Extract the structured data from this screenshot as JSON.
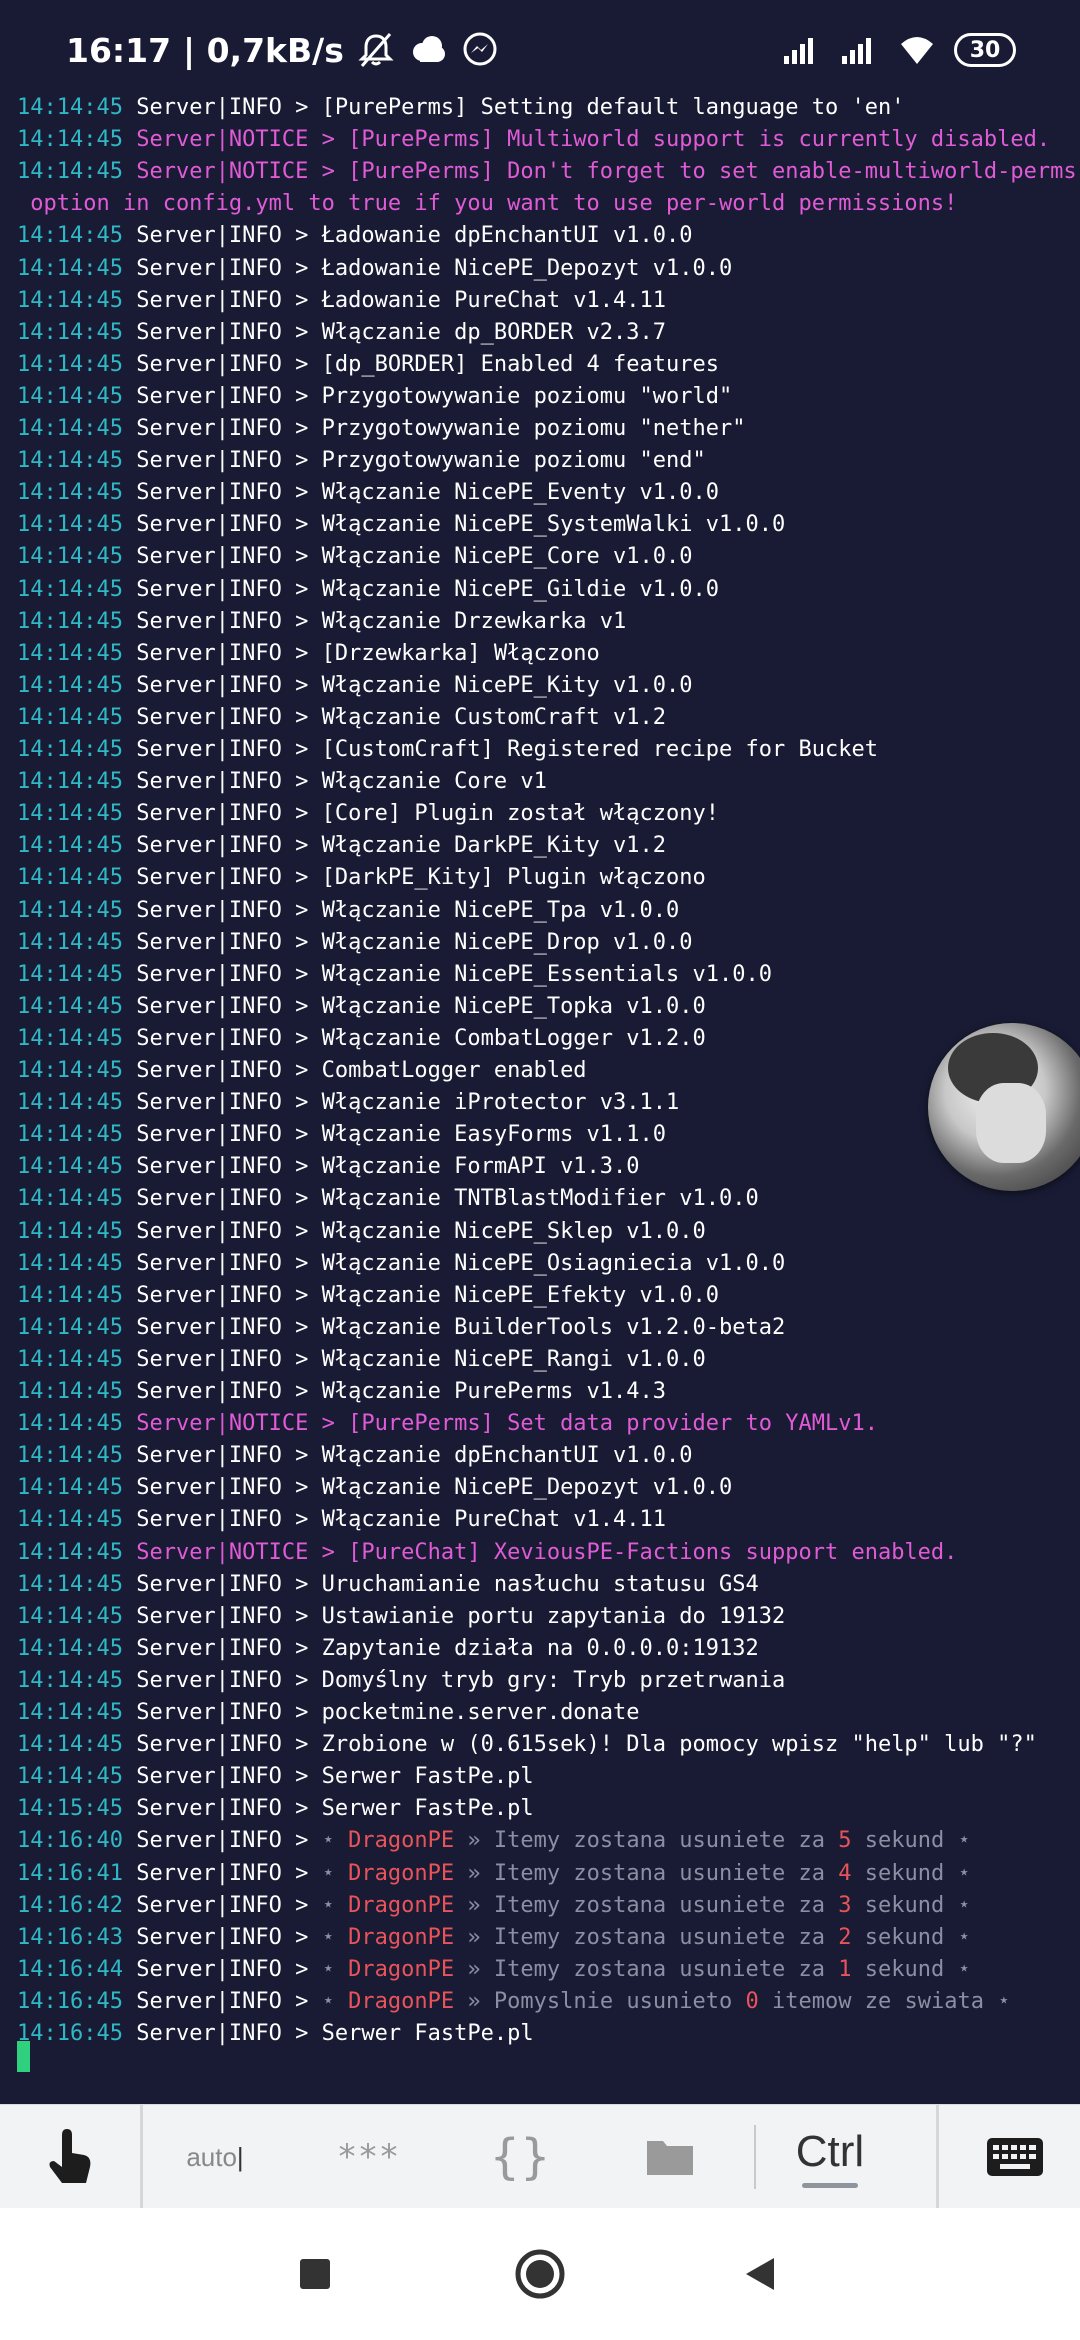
{
  "status_bar": {
    "time": "16:17",
    "network_speed": "| 0,7kB/s",
    "battery": "30",
    "icons": [
      "bell-off-icon",
      "cloud-icon",
      "messenger-icon",
      "signal-icon",
      "signal-icon",
      "wifi-icon"
    ]
  },
  "console": {
    "lines": [
      {
        "ts": "14:14:45",
        "kind": "info",
        "msg": "Server|INFO > [PurePerms] Setting default language to 'en'"
      },
      {
        "ts": "14:14:45",
        "kind": "notice",
        "msg": "Server|NOTICE > [PurePerms] Multiworld support is currently disabled."
      },
      {
        "ts": "14:14:45",
        "kind": "notice",
        "msg": "Server|NOTICE > [PurePerms] Don't forget to set enable-multiworld-perms"
      },
      {
        "ts": "",
        "kind": "notice",
        "msg": " option in config.yml to true if you want to use per-world permissions!"
      },
      {
        "ts": "14:14:45",
        "kind": "info",
        "msg": "Server|INFO > Ładowanie dpEnchantUI v1.0.0"
      },
      {
        "ts": "14:14:45",
        "kind": "info",
        "msg": "Server|INFO > Ładowanie NicePE_Depozyt v1.0.0"
      },
      {
        "ts": "14:14:45",
        "kind": "info",
        "msg": "Server|INFO > Ładowanie PureChat v1.4.11"
      },
      {
        "ts": "14:14:45",
        "kind": "info",
        "msg": "Server|INFO > Włączanie dp_BORDER v2.3.7"
      },
      {
        "ts": "14:14:45",
        "kind": "info",
        "msg": "Server|INFO > [dp_BORDER] Enabled 4 features"
      },
      {
        "ts": "14:14:45",
        "kind": "info",
        "msg": "Server|INFO > Przygotowywanie poziomu \"world\""
      },
      {
        "ts": "14:14:45",
        "kind": "info",
        "msg": "Server|INFO > Przygotowywanie poziomu \"nether\""
      },
      {
        "ts": "14:14:45",
        "kind": "info",
        "msg": "Server|INFO > Przygotowywanie poziomu \"end\""
      },
      {
        "ts": "14:14:45",
        "kind": "info",
        "msg": "Server|INFO > Włączanie NicePE_Eventy v1.0.0"
      },
      {
        "ts": "14:14:45",
        "kind": "info",
        "msg": "Server|INFO > Włączanie NicePE_SystemWalki v1.0.0"
      },
      {
        "ts": "14:14:45",
        "kind": "info",
        "msg": "Server|INFO > Włączanie NicePE_Core v1.0.0"
      },
      {
        "ts": "14:14:45",
        "kind": "info",
        "msg": "Server|INFO > Włączanie NicePE_Gildie v1.0.0"
      },
      {
        "ts": "14:14:45",
        "kind": "info",
        "msg": "Server|INFO > Włączanie Drzewkarka v1"
      },
      {
        "ts": "14:14:45",
        "kind": "info",
        "msg": "Server|INFO > [Drzewkarka] Włączono"
      },
      {
        "ts": "14:14:45",
        "kind": "info",
        "msg": "Server|INFO > Włączanie NicePE_Kity v1.0.0"
      },
      {
        "ts": "14:14:45",
        "kind": "info",
        "msg": "Server|INFO > Włączanie CustomCraft v1.2"
      },
      {
        "ts": "14:14:45",
        "kind": "info",
        "msg": "Server|INFO > [CustomCraft] Registered recipe for Bucket"
      },
      {
        "ts": "14:14:45",
        "kind": "info",
        "msg": "Server|INFO > Włączanie Core v1"
      },
      {
        "ts": "14:14:45",
        "kind": "info",
        "msg": "Server|INFO > [Core] Plugin został włączony!"
      },
      {
        "ts": "14:14:45",
        "kind": "info",
        "msg": "Server|INFO > Włączanie DarkPE_Kity v1.2"
      },
      {
        "ts": "14:14:45",
        "kind": "info",
        "msg": "Server|INFO > [DarkPE_Kity] Plugin włączono"
      },
      {
        "ts": "14:14:45",
        "kind": "info",
        "msg": "Server|INFO > Włączanie NicePE_Tpa v1.0.0"
      },
      {
        "ts": "14:14:45",
        "kind": "info",
        "msg": "Server|INFO > Włączanie NicePE_Drop v1.0.0"
      },
      {
        "ts": "14:14:45",
        "kind": "info",
        "msg": "Server|INFO > Włączanie NicePE_Essentials v1.0.0"
      },
      {
        "ts": "14:14:45",
        "kind": "info",
        "msg": "Server|INFO > Włączanie NicePE_Topka v1.0.0"
      },
      {
        "ts": "14:14:45",
        "kind": "info",
        "msg": "Server|INFO > Włączanie CombatLogger v1.2.0"
      },
      {
        "ts": "14:14:45",
        "kind": "info",
        "msg": "Server|INFO > CombatLogger enabled"
      },
      {
        "ts": "14:14:45",
        "kind": "info",
        "msg": "Server|INFO > Włączanie iProtector v3.1.1"
      },
      {
        "ts": "14:14:45",
        "kind": "info",
        "msg": "Server|INFO > Włączanie EasyForms v1.1.0"
      },
      {
        "ts": "14:14:45",
        "kind": "info",
        "msg": "Server|INFO > Włączanie FormAPI v1.3.0"
      },
      {
        "ts": "14:14:45",
        "kind": "info",
        "msg": "Server|INFO > Włączanie TNTBlastModifier v1.0.0"
      },
      {
        "ts": "14:14:45",
        "kind": "info",
        "msg": "Server|INFO > Włączanie NicePE_Sklep v1.0.0"
      },
      {
        "ts": "14:14:45",
        "kind": "info",
        "msg": "Server|INFO > Włączanie NicePE_Osiagniecia v1.0.0"
      },
      {
        "ts": "14:14:45",
        "kind": "info",
        "msg": "Server|INFO > Włączanie NicePE_Efekty v1.0.0"
      },
      {
        "ts": "14:14:45",
        "kind": "info",
        "msg": "Server|INFO > Włączanie BuilderTools v1.2.0-beta2"
      },
      {
        "ts": "14:14:45",
        "kind": "info",
        "msg": "Server|INFO > Włączanie NicePE_Rangi v1.0.0"
      },
      {
        "ts": "14:14:45",
        "kind": "info",
        "msg": "Server|INFO > Włączanie PurePerms v1.4.3"
      },
      {
        "ts": "14:14:45",
        "kind": "notice",
        "msg": "Server|NOTICE > [PurePerms] Set data provider to YAMLv1."
      },
      {
        "ts": "14:14:45",
        "kind": "info",
        "msg": "Server|INFO > Włączanie dpEnchantUI v1.0.0"
      },
      {
        "ts": "14:14:45",
        "kind": "info",
        "msg": "Server|INFO > Włączanie NicePE_Depozyt v1.0.0"
      },
      {
        "ts": "14:14:45",
        "kind": "info",
        "msg": "Server|INFO > Włączanie PureChat v1.4.11"
      },
      {
        "ts": "14:14:45",
        "kind": "notice",
        "msg": "Server|NOTICE > [PureChat] XeviousPE-Factions support enabled."
      },
      {
        "ts": "14:14:45",
        "kind": "info",
        "msg": "Server|INFO > Uruchamianie nasłuchu statusu GS4"
      },
      {
        "ts": "14:14:45",
        "kind": "info",
        "msg": "Server|INFO > Ustawianie portu zapytania do 19132"
      },
      {
        "ts": "14:14:45",
        "kind": "info",
        "msg": "Server|INFO > Zapytanie działa na 0.0.0.0:19132"
      },
      {
        "ts": "14:14:45",
        "kind": "info",
        "msg": "Server|INFO > Domyślny tryb gry: Tryb przetrwania"
      },
      {
        "ts": "14:14:45",
        "kind": "info",
        "msg": "Server|INFO > pocketmine.server.donate"
      },
      {
        "ts": "14:14:45",
        "kind": "info",
        "msg": "Server|INFO > Zrobione w (0.615sek)! Dla pomocy wpisz \"help\" lub \"?\""
      },
      {
        "ts": "14:14:45",
        "kind": "info",
        "msg": "Server|INFO > Serwer FastPe.pl"
      },
      {
        "ts": "14:15:45",
        "kind": "info",
        "msg": "Server|INFO > Serwer FastPe.pl"
      },
      {
        "ts": "14:16:40",
        "kind": "dragon",
        "prefix": "Server|INFO > ",
        "star": "⋆ ",
        "name": "DragonPE",
        "arrow": " » ",
        "text1": "Itemy zostana usuniete za ",
        "num": "5",
        "text2": " sekund ",
        "star2": "⋆"
      },
      {
        "ts": "14:16:41",
        "kind": "dragon",
        "prefix": "Server|INFO > ",
        "star": "⋆ ",
        "name": "DragonPE",
        "arrow": " » ",
        "text1": "Itemy zostana usuniete za ",
        "num": "4",
        "text2": " sekund ",
        "star2": "⋆"
      },
      {
        "ts": "14:16:42",
        "kind": "dragon",
        "prefix": "Server|INFO > ",
        "star": "⋆ ",
        "name": "DragonPE",
        "arrow": " » ",
        "text1": "Itemy zostana usuniete za ",
        "num": "3",
        "text2": " sekund ",
        "star2": "⋆"
      },
      {
        "ts": "14:16:43",
        "kind": "dragon",
        "prefix": "Server|INFO > ",
        "star": "⋆ ",
        "name": "DragonPE",
        "arrow": " » ",
        "text1": "Itemy zostana usuniete za ",
        "num": "2",
        "text2": " sekund ",
        "star2": "⋆"
      },
      {
        "ts": "14:16:44",
        "kind": "dragon",
        "prefix": "Server|INFO > ",
        "star": "⋆ ",
        "name": "DragonPE",
        "arrow": " » ",
        "text1": "Itemy zostana usuniete za ",
        "num": "1",
        "text2": " sekund ",
        "star2": "⋆"
      },
      {
        "ts": "14:16:45",
        "kind": "dragon",
        "prefix": "Server|INFO > ",
        "star": "⋆ ",
        "name": "DragonPE",
        "arrow": " » ",
        "text1": "Pomyslnie usunieto ",
        "num": "0",
        "text2": " itemow ze swiata ",
        "star2": "⋆"
      },
      {
        "ts": "14:16:45",
        "kind": "info",
        "msg": "Server|INFO > Serwer FastPe.pl"
      }
    ]
  },
  "toolbar": {
    "auto_label": "auto",
    "stars_label": "***",
    "braces_label": "{}",
    "ctrl_label": "Ctrl"
  },
  "colors": {
    "background": "#181b33",
    "timestamp": "#2fb8c6",
    "notice": "#e05bd6",
    "dragon": "#e8545a",
    "cursor": "#2fd07e"
  }
}
